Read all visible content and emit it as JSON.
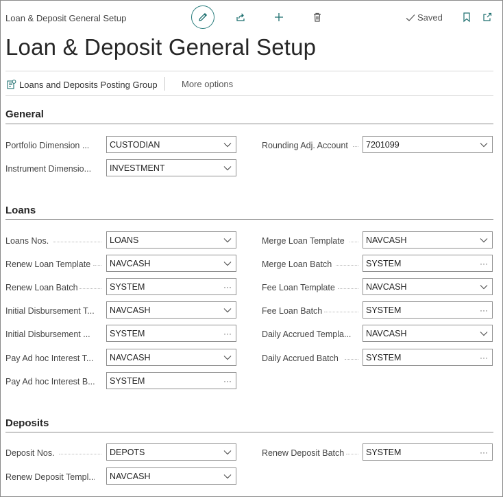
{
  "header": {
    "breadcrumb": "Loan & Deposit General Setup",
    "saved_label": "Saved",
    "title": "Loan & Deposit General Setup"
  },
  "actions": {
    "posting_group": "Loans and Deposits Posting Group",
    "more_options": "More options"
  },
  "sections": {
    "general": {
      "title": "General",
      "fields": {
        "portfolio_dim": {
          "label": "Portfolio Dimension ...",
          "value": "CUSTODIAN"
        },
        "instrument_dim": {
          "label": "Instrument Dimensio...",
          "value": "INVESTMENT"
        },
        "rounding_acc": {
          "label": "Rounding Adj. Account",
          "value": "7201099"
        }
      }
    },
    "loans": {
      "title": "Loans",
      "fields": {
        "loan_nos": {
          "label": "Loans Nos.",
          "value": "LOANS"
        },
        "renew_loan_template": {
          "label": "Renew Loan Template",
          "value": "NAVCASH"
        },
        "renew_loan_batch": {
          "label": "Renew Loan Batch",
          "value": "SYSTEM"
        },
        "initial_disb_template": {
          "label": "Initial Disbursement T...",
          "value": "NAVCASH"
        },
        "initial_disb_batch": {
          "label": "Initial Disbursement ...",
          "value": "SYSTEM"
        },
        "pay_adhoc_template": {
          "label": "Pay Ad hoc Interest T...",
          "value": "NAVCASH"
        },
        "pay_adhoc_batch": {
          "label": "Pay Ad hoc Interest B...",
          "value": "SYSTEM"
        },
        "merge_loan_template": {
          "label": "Merge Loan Template",
          "value": "NAVCASH"
        },
        "merge_loan_batch": {
          "label": "Merge Loan Batch",
          "value": "SYSTEM"
        },
        "fee_loan_template": {
          "label": "Fee Loan Template",
          "value": "NAVCASH"
        },
        "fee_loan_batch": {
          "label": "Fee Loan Batch",
          "value": "SYSTEM"
        },
        "daily_accrued_template": {
          "label": "Daily Accrued Templa...",
          "value": "NAVCASH"
        },
        "daily_accrued_batch": {
          "label": "Daily Accrued Batch",
          "value": "SYSTEM"
        }
      }
    },
    "deposits": {
      "title": "Deposits",
      "fields": {
        "deposit_nos": {
          "label": "Deposit Nos.",
          "value": "DEPOTS"
        },
        "renew_deposit_template": {
          "label": "Renew Deposit Templ...",
          "value": "NAVCASH"
        },
        "renew_deposit_batch": {
          "label": "Renew Deposit Batch",
          "value": "SYSTEM"
        }
      }
    }
  },
  "controls": {
    "dropdown": "chevron-down-icon",
    "lookup": "ellipsis-icon"
  },
  "colors": {
    "accent": "#1d6f6f",
    "rule": "#8a8a8a"
  }
}
